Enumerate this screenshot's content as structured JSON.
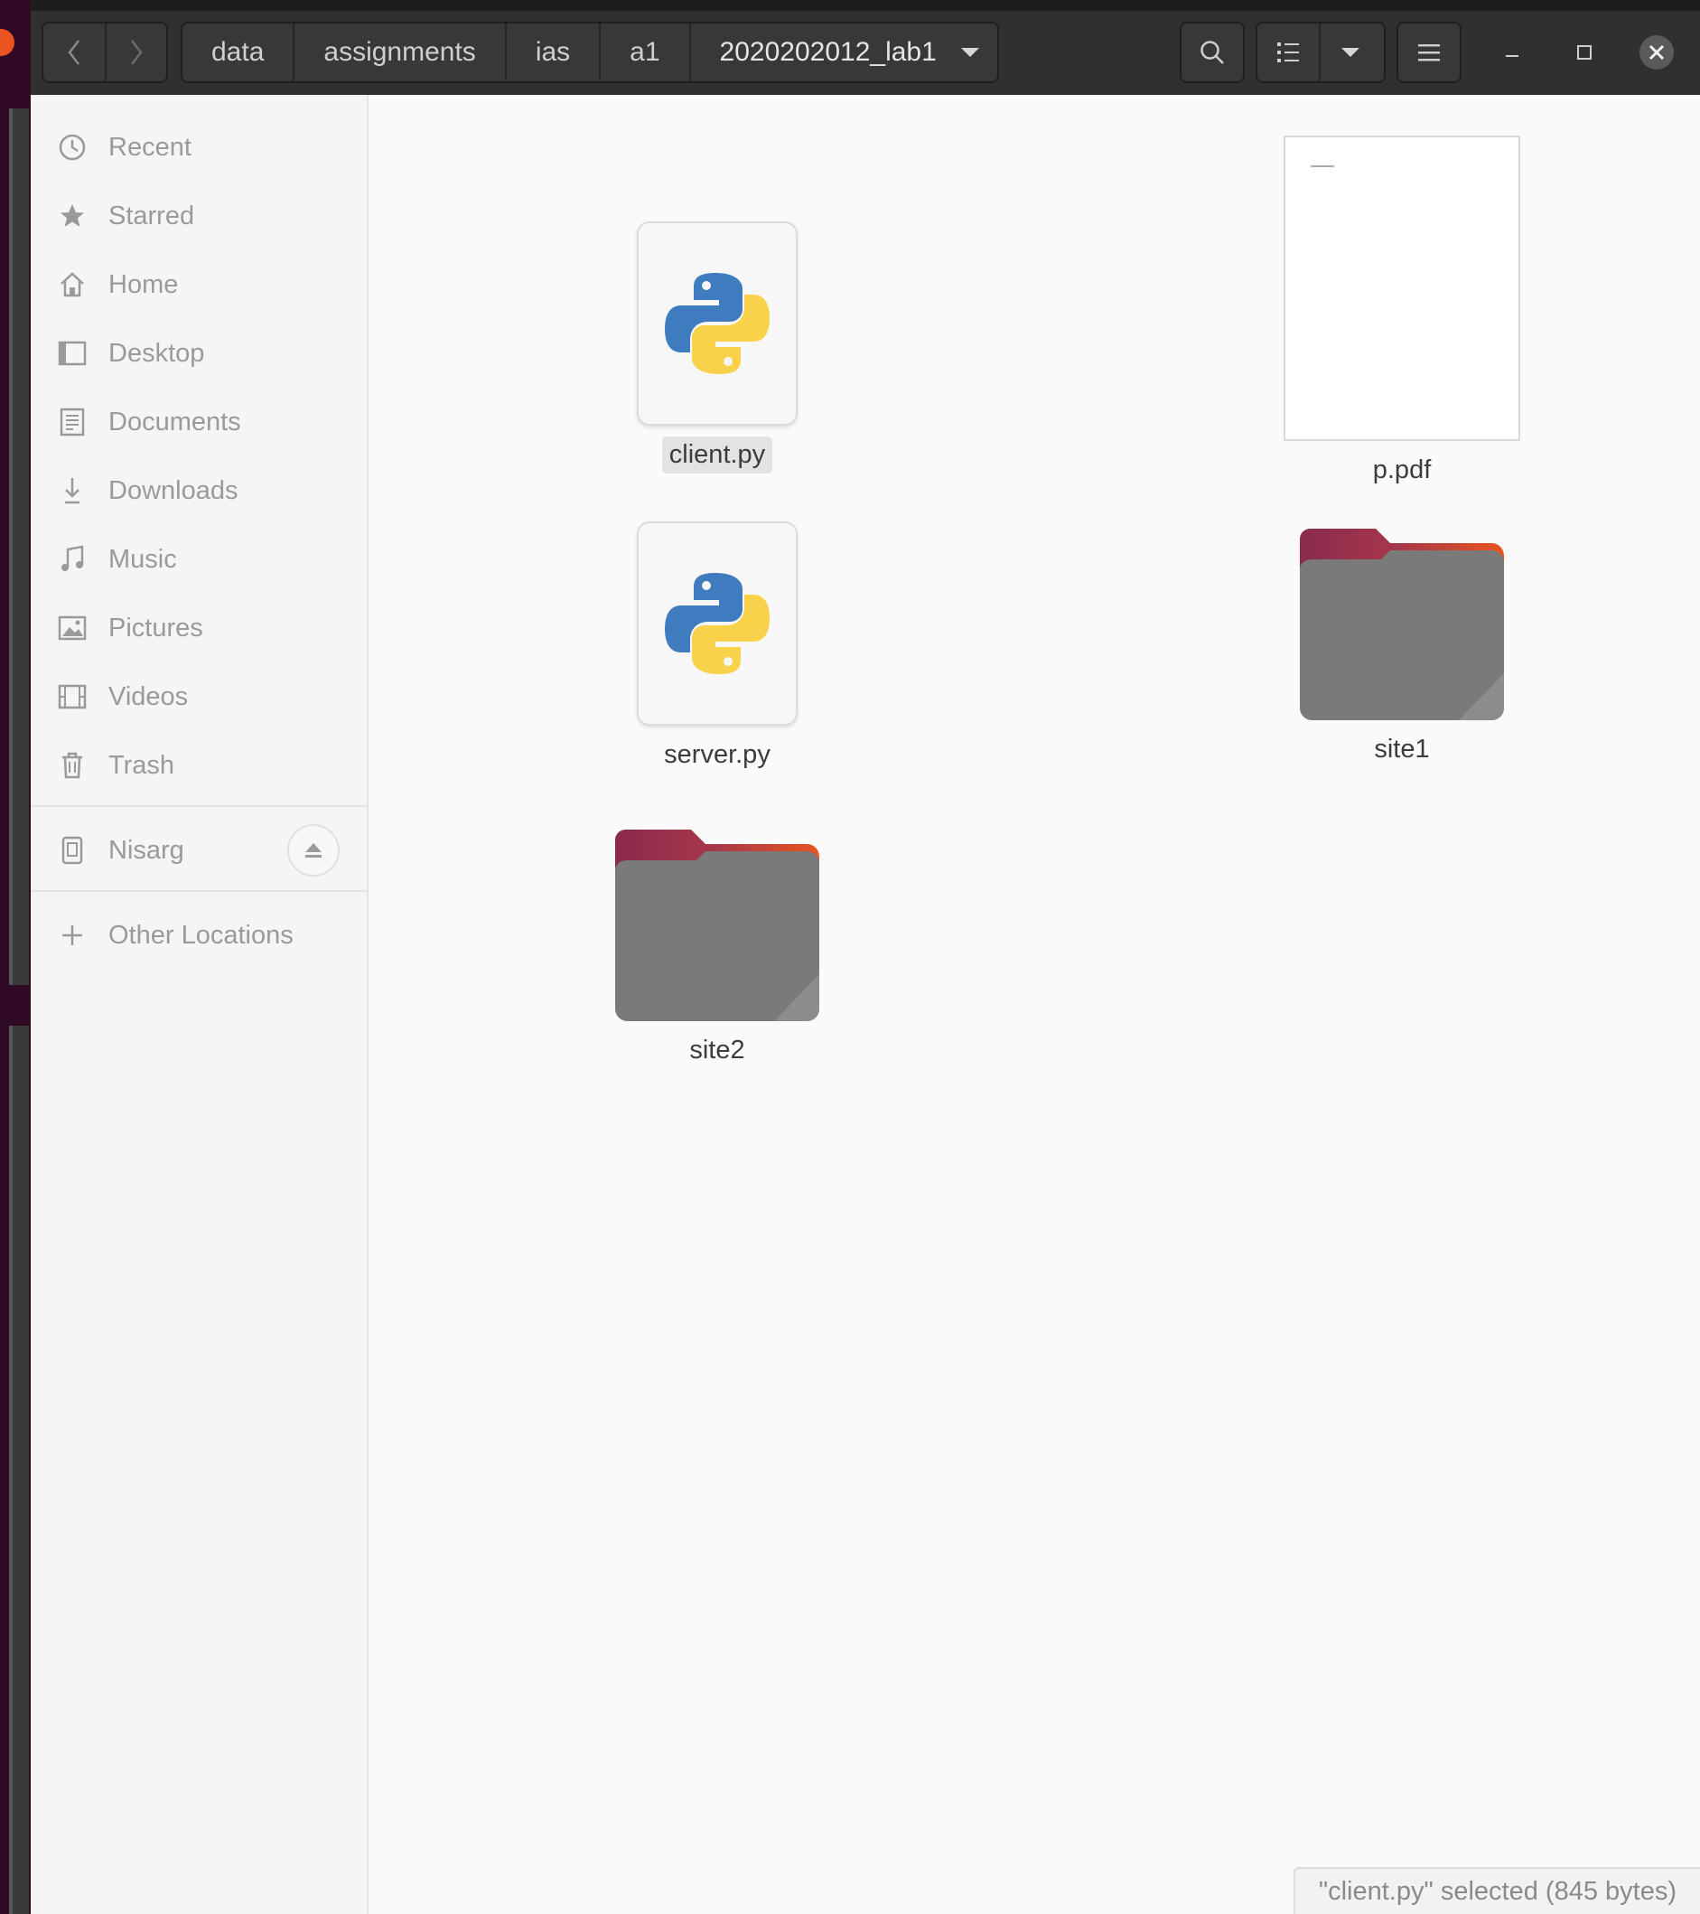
{
  "headerbar": {
    "breadcrumbs": [
      "data",
      "assignments",
      "ias",
      "a1",
      "2020202012_lab1"
    ],
    "icons": {
      "back": "chevron-left-icon",
      "forward": "chevron-right-icon",
      "path_menu": "caret-down-icon",
      "search": "search-icon",
      "view": "list-view-icon",
      "view_options": "caret-down-icon",
      "menu": "hamburger-menu-icon",
      "minimize": "minimize-icon",
      "maximize": "maximize-icon",
      "close": "close-icon"
    }
  },
  "sidebar": {
    "places": [
      {
        "label": "Recent",
        "icon": "clock-icon"
      },
      {
        "label": "Starred",
        "icon": "star-icon"
      },
      {
        "label": "Home",
        "icon": "home-icon"
      },
      {
        "label": "Desktop",
        "icon": "desktop-icon"
      },
      {
        "label": "Documents",
        "icon": "document-icon"
      },
      {
        "label": "Downloads",
        "icon": "download-icon"
      },
      {
        "label": "Music",
        "icon": "music-note-icon"
      },
      {
        "label": "Pictures",
        "icon": "picture-icon"
      },
      {
        "label": "Videos",
        "icon": "film-icon"
      },
      {
        "label": "Trash",
        "icon": "trash-icon"
      }
    ],
    "devices": [
      {
        "label": "Nisarg",
        "icon": "drive-icon",
        "action_icon": "eject-icon"
      }
    ],
    "other": {
      "label": "Other Locations",
      "icon": "plus-icon"
    }
  },
  "files": [
    {
      "name": "client.py",
      "type": "python",
      "selected": true
    },
    {
      "name": "p.pdf",
      "type": "pdf",
      "selected": false
    },
    {
      "name": "server.py",
      "type": "python",
      "selected": false
    },
    {
      "name": "site1",
      "type": "folder",
      "selected": false
    },
    {
      "name": "site2",
      "type": "folder",
      "selected": false
    }
  ],
  "status": {
    "text": "\"client.py\" selected  (845 bytes)"
  },
  "colors": {
    "headerbar": "#303030",
    "sidebar": "#f5f5f5",
    "content": "#fafafa",
    "folder_body": "#7a7a7a",
    "folder_tab_start": "#8a2a4e",
    "folder_tab_end": "#e95420",
    "python_blue": "#3e7bbf",
    "python_yellow": "#f7d24a",
    "ubuntu_orange": "#e95420"
  }
}
